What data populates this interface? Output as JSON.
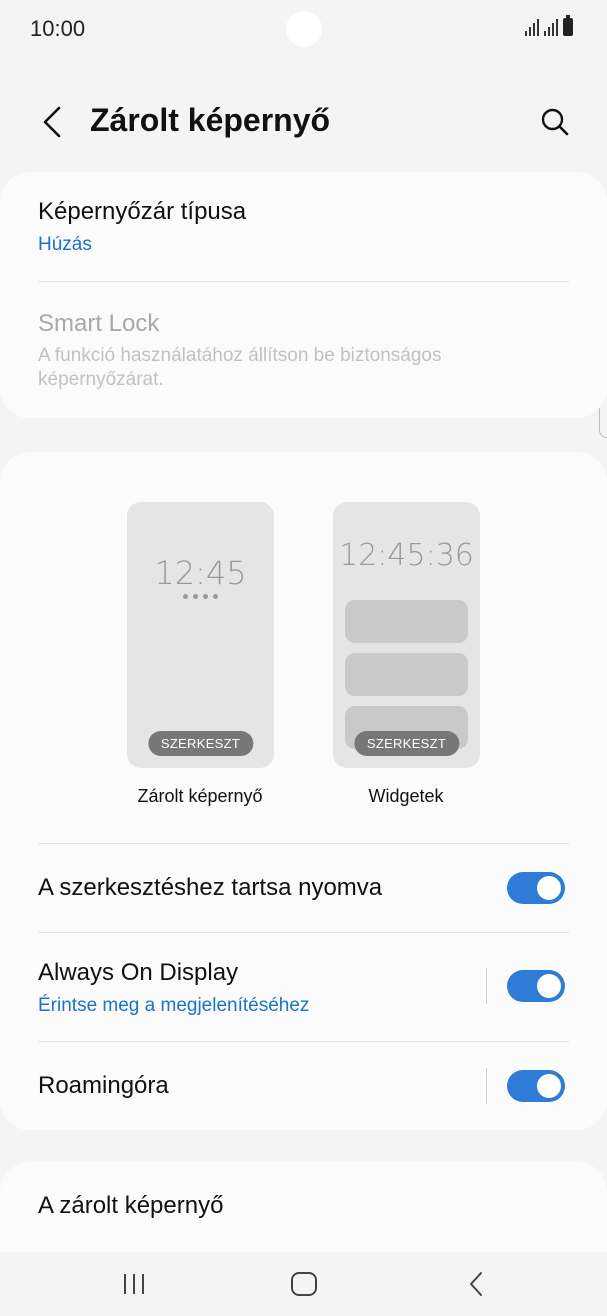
{
  "status_bar": {
    "time": "10:00"
  },
  "header": {
    "title": "Zárolt képernyő"
  },
  "lock_type": {
    "title": "Képernyőzár típusa",
    "value": "Húzás"
  },
  "smart_lock": {
    "title": "Smart Lock",
    "subtitle": "A funkció használatához állítson be biztonságos képernyőzárat."
  },
  "previews": {
    "lock": {
      "clock": "12:45",
      "edit_label": "SZERKESZT",
      "caption": "Zárolt képernyő"
    },
    "widgets": {
      "clock": "12:45:36",
      "edit_label": "SZERKESZT",
      "caption": "Widgetek"
    }
  },
  "settings": {
    "hold_to_edit": {
      "title": "A szerkesztéshez tartsa nyomva",
      "enabled": true
    },
    "always_on_display": {
      "title": "Always On Display",
      "subtitle": "Érintse meg a megjelenítéséhez",
      "enabled": true
    },
    "roaming_clock": {
      "title": "Roamingóra",
      "enabled": true
    }
  },
  "next_section": {
    "title": "A zárolt képernyő"
  },
  "colors": {
    "accent": "#2e7cd6",
    "link": "#1a73c8",
    "background": "#f4f4f4",
    "card": "#fbfbfb"
  }
}
